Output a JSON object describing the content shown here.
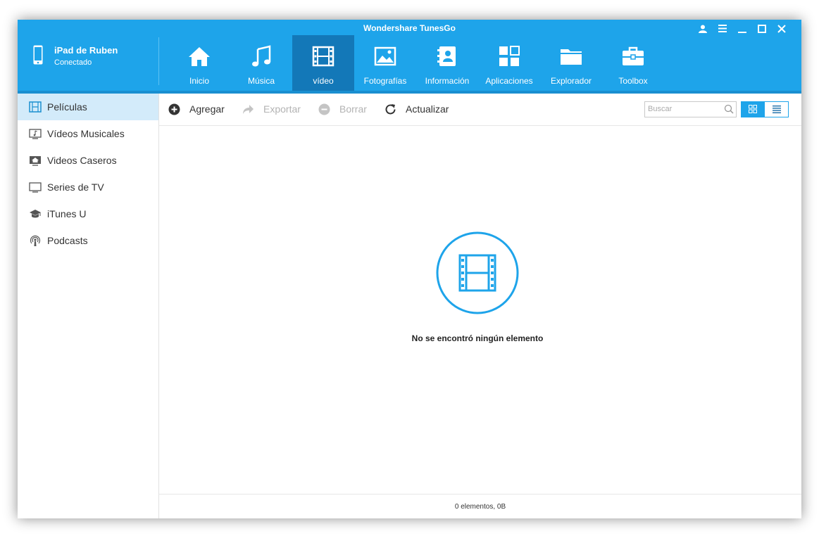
{
  "app": {
    "title": "Wondershare TunesGo"
  },
  "window_controls": {
    "user": "👤",
    "menu": "☰",
    "minimize": "—",
    "maximize": "☐",
    "close": "✕"
  },
  "device": {
    "name": "iPad de Ruben",
    "status": "Conectado"
  },
  "tabs": [
    {
      "label": "Inicio",
      "icon": "home-icon"
    },
    {
      "label": "Música",
      "icon": "music-icon"
    },
    {
      "label": "vídeo",
      "icon": "film-icon",
      "active": true
    },
    {
      "label": "Fotografías",
      "icon": "photo-icon"
    },
    {
      "label": "Información",
      "icon": "contacts-icon"
    },
    {
      "label": "Aplicaciones",
      "icon": "apps-icon"
    },
    {
      "label": "Explorador",
      "icon": "folder-icon"
    },
    {
      "label": "Toolbox",
      "icon": "toolbox-icon"
    }
  ],
  "sidebar": {
    "items": [
      {
        "label": "Películas",
        "icon": "film-icon",
        "active": true
      },
      {
        "label": "Vídeos Musicales",
        "icon": "music-video-icon"
      },
      {
        "label": "Videos Caseros",
        "icon": "home-video-icon"
      },
      {
        "label": "Series de TV",
        "icon": "tv-icon"
      },
      {
        "label": "iTunes U",
        "icon": "graduation-cap-icon"
      },
      {
        "label": "Podcasts",
        "icon": "podcast-icon"
      }
    ]
  },
  "toolbar": {
    "add": "Agregar",
    "export": "Exportar",
    "delete": "Borrar",
    "refresh": "Actualizar",
    "search_placeholder": "Buscar"
  },
  "empty_state": {
    "message": "No se encontró ningún elemento"
  },
  "status": {
    "summary": "0 elementos, 0B"
  },
  "colors": {
    "accent": "#1ea4ea",
    "active_tab": "#1378b8",
    "sidebar_active": "#d3ebfa"
  }
}
